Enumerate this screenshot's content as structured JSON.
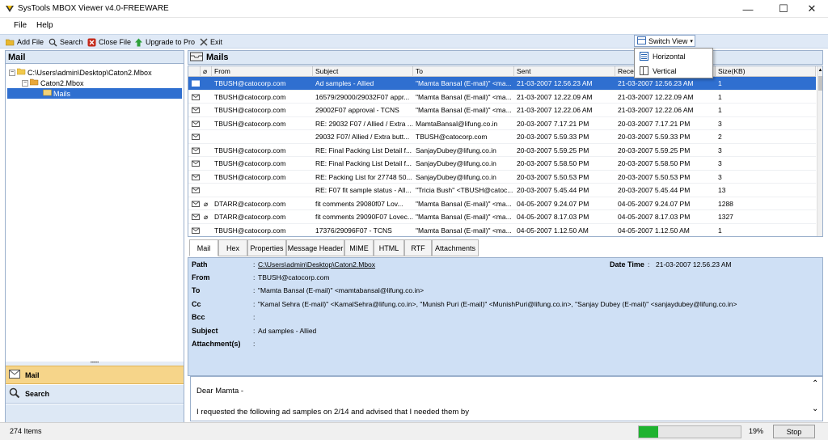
{
  "window": {
    "title": "SysTools MBOX Viewer v4.0-FREEWARE"
  },
  "menu": [
    "File",
    "Help"
  ],
  "toolbar": {
    "add_file": "Add File",
    "search": "Search",
    "close_file": "Close File",
    "upgrade": "Upgrade to Pro",
    "exit": "Exit"
  },
  "switch_view": {
    "label": "Switch View",
    "options": [
      "Horizontal",
      "Vertical"
    ]
  },
  "left": {
    "header": "Mail",
    "tree": [
      "C:\\Users\\admin\\Desktop\\Caton2.Mbox",
      "Caton2.Mbox",
      "Mails"
    ],
    "nav": [
      "Mail",
      "Search"
    ]
  },
  "mail_list": {
    "header": "Mails",
    "columns": [
      "From",
      "Subject",
      "To",
      "Sent",
      "Recei",
      "Size(KB)"
    ],
    "rows": [
      {
        "from": "TBUSH@catocorp.com",
        "subject": "Ad samples - Allied",
        "to": "\"Mamta Bansal (E-mail)\" <ma...",
        "sent": "21-03-2007 12.56.23 AM",
        "received": "21-03-2007 12.56.23 AM",
        "size": "1",
        "attach": false
      },
      {
        "from": "TBUSH@catocorp.com",
        "subject": "16579/29000/29032F07 appr...",
        "to": "\"Mamta Bansal (E-mail)\" <ma...",
        "sent": "21-03-2007 12.22.09 AM",
        "received": "21-03-2007 12.22.09 AM",
        "size": "1",
        "attach": false
      },
      {
        "from": "TBUSH@catocorp.com",
        "subject": "29002F07 approval - TCNS",
        "to": "\"Mamta Bansal (E-mail)\" <ma...",
        "sent": "21-03-2007 12.22.06 AM",
        "received": "21-03-2007 12.22.06 AM",
        "size": "1",
        "attach": false
      },
      {
        "from": "TBUSH@catocorp.com",
        "subject": "RE: 29032 F07 / Allied / Extra ...",
        "to": "MamtaBansal@lifung.co.in",
        "sent": "20-03-2007 7.17.21 PM",
        "received": "20-03-2007 7.17.21 PM",
        "size": "3",
        "attach": false
      },
      {
        "from": "",
        "subject": "29032 F07/ Allied / Extra butt...",
        "to": "TBUSH@catocorp.com",
        "sent": "20-03-2007 5.59.33 PM",
        "received": "20-03-2007 5.59.33 PM",
        "size": "2",
        "attach": false
      },
      {
        "from": "TBUSH@catocorp.com",
        "subject": "RE: Final Packing List Detail f...",
        "to": "SanjayDubey@lifung.co.in",
        "sent": "20-03-2007 5.59.25 PM",
        "received": "20-03-2007 5.59.25 PM",
        "size": "3",
        "attach": false
      },
      {
        "from": "TBUSH@catocorp.com",
        "subject": "RE: Final Packing List Detail f...",
        "to": "SanjayDubey@lifung.co.in",
        "sent": "20-03-2007 5.58.50 PM",
        "received": "20-03-2007 5.58.50 PM",
        "size": "3",
        "attach": false
      },
      {
        "from": "TBUSH@catocorp.com",
        "subject": "RE: Packing List for 27748 50...",
        "to": "SanjayDubey@lifung.co.in",
        "sent": "20-03-2007 5.50.53 PM",
        "received": "20-03-2007 5.50.53 PM",
        "size": "3",
        "attach": false
      },
      {
        "from": "",
        "subject": "RE: F07 fit sample status - All...",
        "to": "\"Tricia Bush\" <TBUSH@catoc...",
        "sent": "20-03-2007 5.45.44 PM",
        "received": "20-03-2007 5.45.44 PM",
        "size": "13",
        "attach": false
      },
      {
        "from": "DTARR@catocorp.com",
        "subject": "fit comments 29080f07    Lov...",
        "to": "\"Mamta Bansal (E-mail)\" <ma...",
        "sent": "04-05-2007 9.24.07 PM",
        "received": "04-05-2007 9.24.07 PM",
        "size": "1288",
        "attach": true
      },
      {
        "from": "DTARR@catocorp.com",
        "subject": "fit comments 29090F07 Lovec...",
        "to": "\"Mamta Bansal (E-mail)\" <ma...",
        "sent": "04-05-2007 8.17.03 PM",
        "received": "04-05-2007 8.17.03 PM",
        "size": "1327",
        "attach": true
      },
      {
        "from": "TBUSH@catocorp.com",
        "subject": "17376/29096F07 - TCNS",
        "to": "\"Mamta Bansal (E-mail)\" <ma...",
        "sent": "04-05-2007 1.12.50 AM",
        "received": "04-05-2007 1.12.50 AM",
        "size": "1",
        "attach": false
      }
    ]
  },
  "tabs": [
    "Mail",
    "Hex",
    "Properties",
    "Message Header",
    "MIME",
    "HTML",
    "RTF",
    "Attachments"
  ],
  "detail": {
    "path_label": "Path",
    "path_value": "C:\\Users\\admin\\Desktop\\Caton2.Mbox",
    "date_label": "Date Time",
    "date_value": "21-03-2007 12.56.23 AM",
    "from_label": "From",
    "from_value": "TBUSH@catocorp.com",
    "to_label": "To",
    "to_value": "\"Mamta Bansal (E-mail)\" <mamtabansal@lifung.co.in>",
    "cc_label": "Cc",
    "cc_value": "\"Kamal Sehra (E-mail)\" <KamalSehra@lifung.co.in>, \"Munish Puri (E-mail)\" <MunishPuri@lifung.co.in>, \"Sanjay Dubey (E-mail)\" <sanjaydubey@lifung.co.in>",
    "bcc_label": "Bcc",
    "bcc_value": "",
    "subject_label": "Subject",
    "subject_value": "Ad samples - Allied",
    "attach_label": "Attachment(s)",
    "attach_value": ""
  },
  "body": {
    "greeting": "Dear Mamta -",
    "line1": "I requested the following ad samples on 2/14 and advised that I needed them by"
  },
  "status": {
    "items": "274 Items",
    "progress_percent": "19%",
    "progress_value": 0.19,
    "stop": "Stop"
  },
  "colors": {
    "selection": "#2f6fd0",
    "panel_blue": "#cfe0f5",
    "progress": "#1fb330"
  }
}
